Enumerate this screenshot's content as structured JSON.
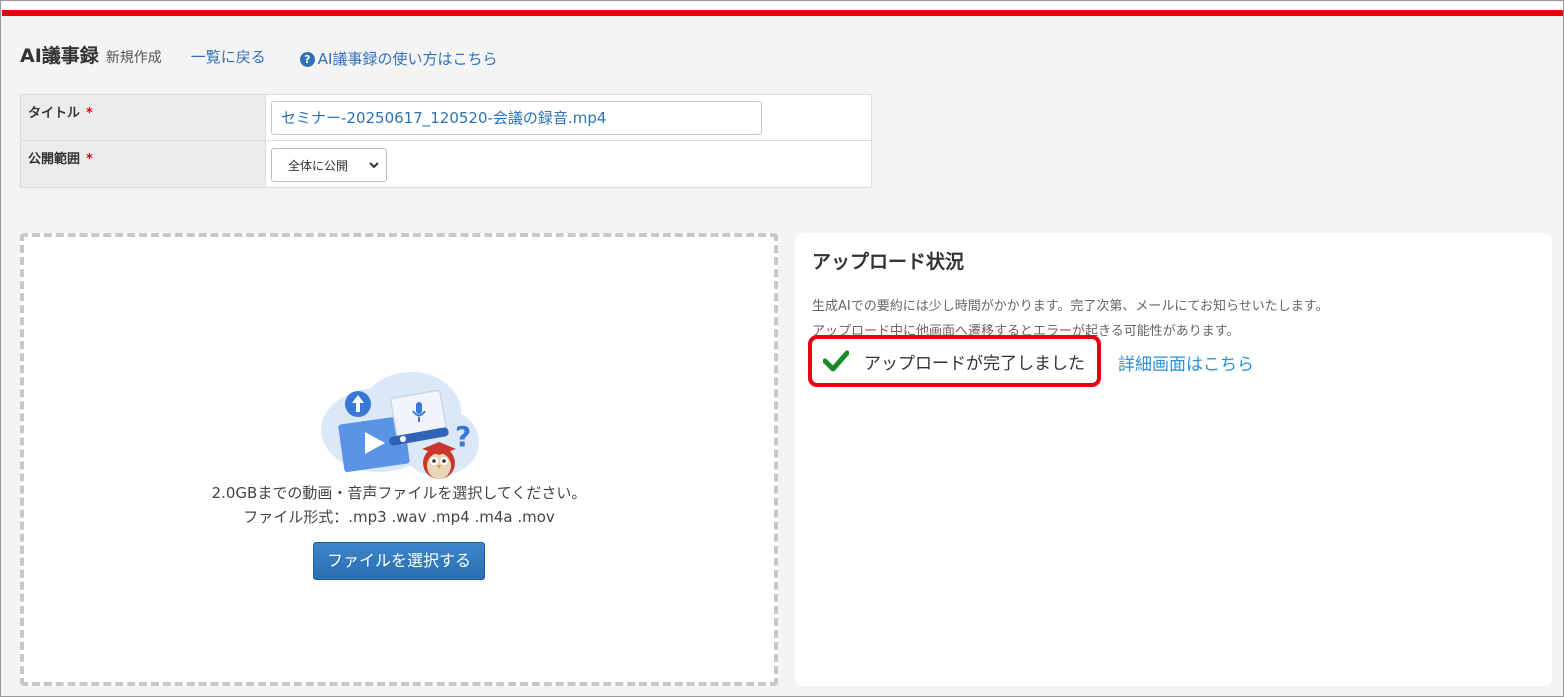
{
  "header": {
    "title": "AI議事録",
    "subtitle": "新規作成",
    "back_link": "一覧に戻る",
    "help_link": "AI議事録の使い方はこちら",
    "help_icon": "?"
  },
  "form": {
    "title_label": "タイトル",
    "title_value": "セミナー-20250617_120520-会議の録音.mp4",
    "visibility_label": "公開範囲",
    "visibility_value": "全体に公開",
    "required_mark": "*"
  },
  "upload": {
    "instruction": "2.0GBまでの動画・音声ファイルを選択してください。",
    "formats": "ファイル形式：.mp3 .wav .mp4 .m4a .mov",
    "select_button": "ファイルを選択する"
  },
  "status": {
    "title": "アップロード状況",
    "note1": "生成AIでの要約には少し時間がかかります。完了次第、メールにてお知らせいたします。",
    "note2": "アップロード中に他画面へ遷移するとエラーが起きる可能性があります。",
    "complete_message": "アップロードが完了しました",
    "detail_link": "詳細画面はこちら"
  },
  "colors": {
    "brand_red": "#e60012",
    "link_blue": "#2d72b8",
    "button_blue": "#2f74b8",
    "check_green": "#1a8a28"
  }
}
